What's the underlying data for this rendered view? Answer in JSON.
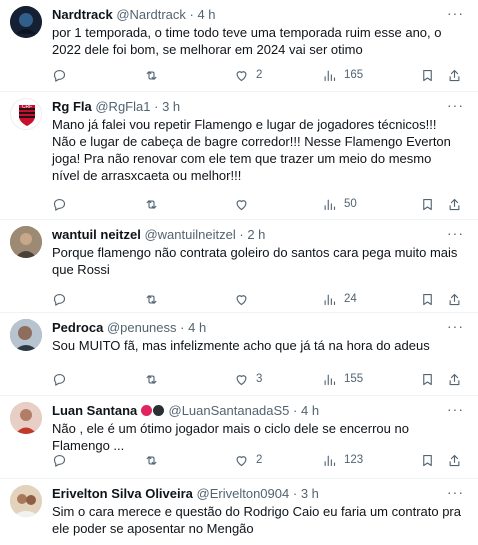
{
  "tweets": [
    {
      "name": "Nardtrack",
      "handle": "@Nardtrack",
      "time": "4 h",
      "text": "por 1 temporada, o time todo teve uma temporada ruim esse ano, o 2022 dele foi bom, se melhorar em 2024 vai ser otimo",
      "replies": "",
      "retweets": "",
      "likes": "2",
      "views": "165"
    },
    {
      "name": "Rg Fla",
      "handle": "@RgFla1",
      "time": "3 h",
      "text": "Mano já falei vou repetir Flamengo e lugar de jogadores técnicos!!!  Não e lugar de cabeça de bagre corredor!!!  Nesse Flamengo Everton joga! Pra não renovar com ele tem que trazer um meio do mesmo nível de arrasxcaeta ou melhor!!!",
      "replies": "",
      "retweets": "",
      "likes": "",
      "views": "50"
    },
    {
      "name": "wantuil neitzel",
      "handle": "@wantuilneitzel",
      "time": "2 h",
      "text": "Porque flamengo não contrata goleiro do santos cara pega muito mais que Rossi",
      "replies": "",
      "retweets": "",
      "likes": "",
      "views": "24"
    },
    {
      "name": "Pedroca",
      "handle": "@penuness",
      "time": "4 h",
      "text": "Sou MUITO fã, mas infelizmente acho que já tá na hora do adeus",
      "replies": "",
      "retweets": "",
      "likes": "3",
      "views": "155"
    },
    {
      "name": "Luan Santana",
      "handle": "@LuanSantanadaS5",
      "time": "4 h",
      "text": "Não , ele é um ótimo jogador mais o ciclo dele se encerrou no Flamengo ...",
      "replies": "",
      "retweets": "",
      "likes": "2",
      "views": "123"
    },
    {
      "name": "Erivelton Silva Oliveira",
      "handle": "@Erivelton0904",
      "time": "3 h",
      "text": "Sim o cara merece e questão do Rodrigo Caio eu faria um contrato pra ele poder se aposentar no Mengão",
      "replies": "",
      "retweets": "",
      "likes": "",
      "views": ""
    }
  ],
  "separator": "·",
  "more_label": "···",
  "colors": {
    "text": "#0f1419",
    "secondary": "#536471",
    "divider": "#eff3f4",
    "emoji_red": "#e0245e",
    "emoji_black": "#292f33"
  },
  "icons": [
    "more-icon",
    "reply-icon",
    "retweet-icon",
    "like-icon",
    "views-icon",
    "bookmark-icon",
    "share-icon"
  ]
}
